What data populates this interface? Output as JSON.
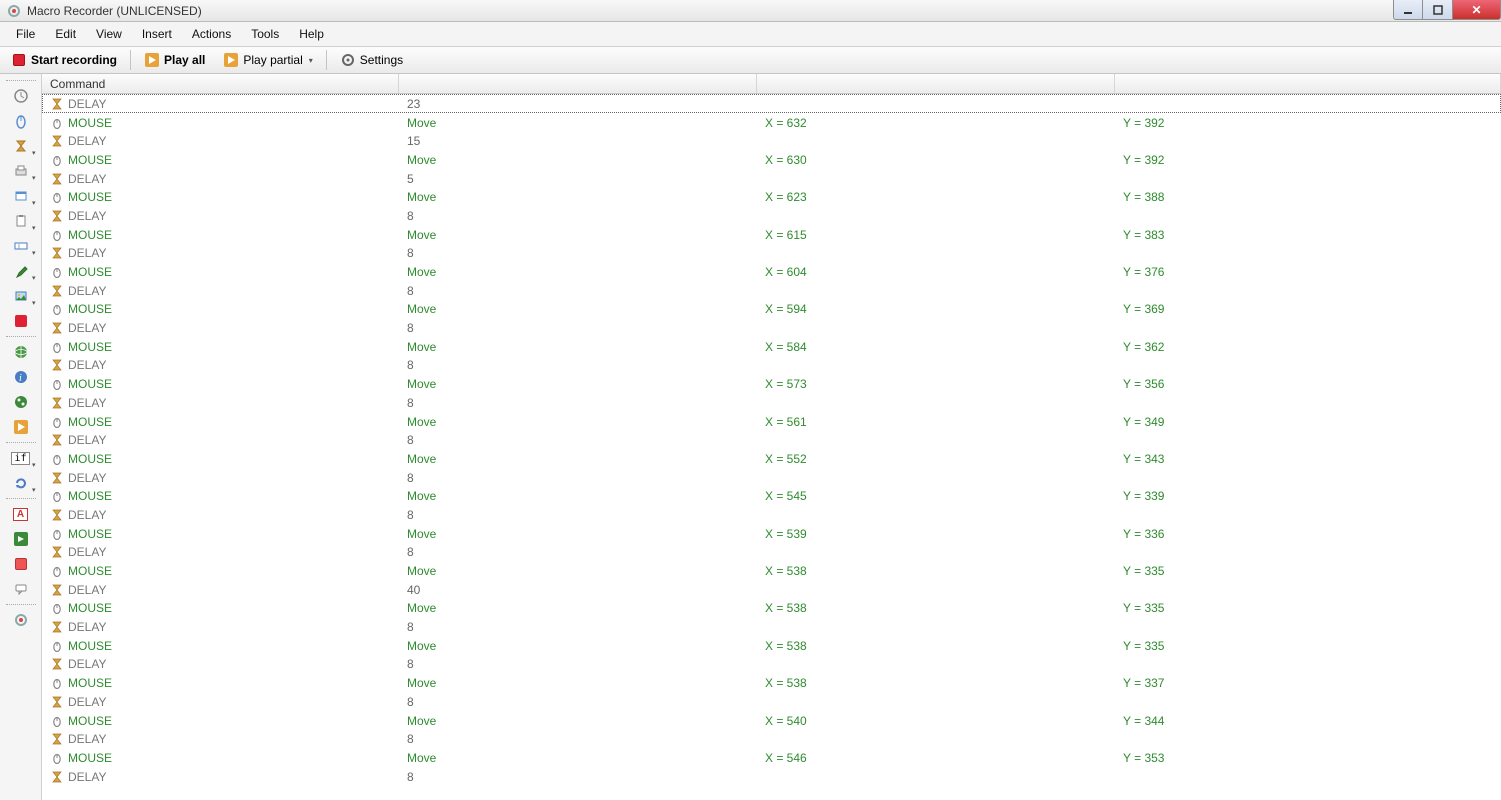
{
  "window": {
    "title": "Macro Recorder (UNLICENSED)"
  },
  "menu": [
    "File",
    "Edit",
    "View",
    "Insert",
    "Actions",
    "Tools",
    "Help"
  ],
  "toolbar": {
    "record": "Start recording",
    "play_all": "Play all",
    "play_partial": "Play partial",
    "settings": "Settings"
  },
  "grid": {
    "header": "Command",
    "rows": [
      {
        "t": "DELAY",
        "v": "23",
        "sel": true
      },
      {
        "t": "MOUSE",
        "a": "Move",
        "x": "X = 632",
        "y": "Y = 392"
      },
      {
        "t": "DELAY",
        "v": "15"
      },
      {
        "t": "MOUSE",
        "a": "Move",
        "x": "X = 630",
        "y": "Y = 392"
      },
      {
        "t": "DELAY",
        "v": "5"
      },
      {
        "t": "MOUSE",
        "a": "Move",
        "x": "X = 623",
        "y": "Y = 388"
      },
      {
        "t": "DELAY",
        "v": "8"
      },
      {
        "t": "MOUSE",
        "a": "Move",
        "x": "X = 615",
        "y": "Y = 383"
      },
      {
        "t": "DELAY",
        "v": "8"
      },
      {
        "t": "MOUSE",
        "a": "Move",
        "x": "X = 604",
        "y": "Y = 376"
      },
      {
        "t": "DELAY",
        "v": "8"
      },
      {
        "t": "MOUSE",
        "a": "Move",
        "x": "X = 594",
        "y": "Y = 369"
      },
      {
        "t": "DELAY",
        "v": "8"
      },
      {
        "t": "MOUSE",
        "a": "Move",
        "x": "X = 584",
        "y": "Y = 362"
      },
      {
        "t": "DELAY",
        "v": "8"
      },
      {
        "t": "MOUSE",
        "a": "Move",
        "x": "X = 573",
        "y": "Y = 356"
      },
      {
        "t": "DELAY",
        "v": "8"
      },
      {
        "t": "MOUSE",
        "a": "Move",
        "x": "X = 561",
        "y": "Y = 349"
      },
      {
        "t": "DELAY",
        "v": "8"
      },
      {
        "t": "MOUSE",
        "a": "Move",
        "x": "X = 552",
        "y": "Y = 343"
      },
      {
        "t": "DELAY",
        "v": "8"
      },
      {
        "t": "MOUSE",
        "a": "Move",
        "x": "X = 545",
        "y": "Y = 339"
      },
      {
        "t": "DELAY",
        "v": "8"
      },
      {
        "t": "MOUSE",
        "a": "Move",
        "x": "X = 539",
        "y": "Y = 336"
      },
      {
        "t": "DELAY",
        "v": "8"
      },
      {
        "t": "MOUSE",
        "a": "Move",
        "x": "X = 538",
        "y": "Y = 335"
      },
      {
        "t": "DELAY",
        "v": "40"
      },
      {
        "t": "MOUSE",
        "a": "Move",
        "x": "X = 538",
        "y": "Y = 335"
      },
      {
        "t": "DELAY",
        "v": "8"
      },
      {
        "t": "MOUSE",
        "a": "Move",
        "x": "X = 538",
        "y": "Y = 335"
      },
      {
        "t": "DELAY",
        "v": "8"
      },
      {
        "t": "MOUSE",
        "a": "Move",
        "x": "X = 538",
        "y": "Y = 337"
      },
      {
        "t": "DELAY",
        "v": "8"
      },
      {
        "t": "MOUSE",
        "a": "Move",
        "x": "X = 540",
        "y": "Y = 344"
      },
      {
        "t": "DELAY",
        "v": "8"
      },
      {
        "t": "MOUSE",
        "a": "Move",
        "x": "X = 546",
        "y": "Y = 353"
      },
      {
        "t": "DELAY",
        "v": "8"
      }
    ]
  },
  "leftstrip_icons": [
    "clock-icon",
    "mouse-icon",
    "hourglass-icon",
    "print-icon",
    "window-icon",
    "clipboard-icon",
    "text-input-icon",
    "eyedropper-icon",
    "image-icon",
    "stop-icon",
    "globe-icon",
    "info-icon",
    "network-icon",
    "play-icon",
    "if-statement-icon",
    "refresh-icon",
    "font-icon",
    "goto-icon",
    "record-square-icon",
    "comment-icon",
    "macro-icon"
  ]
}
